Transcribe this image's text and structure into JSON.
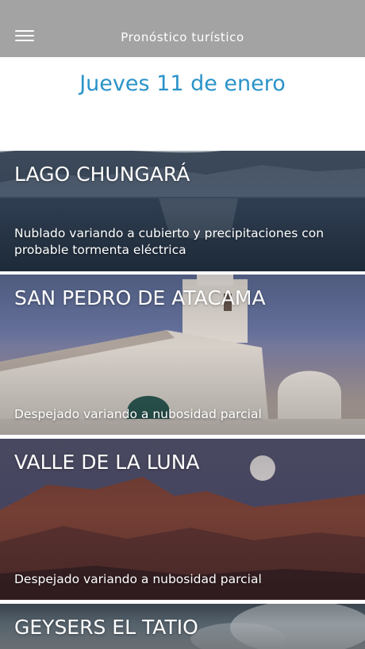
{
  "header": {
    "title": "Pronóstico turístico"
  },
  "date": "Jueves 11 de enero",
  "cards": [
    {
      "name": "LAGO CHUNGARÁ",
      "forecast": "Nublado variando a cubierto y precipitaciones con probable tormenta eléctrica"
    },
    {
      "name": "SAN PEDRO DE ATACAMA",
      "forecast": "Despejado variando a nubosidad parcial"
    },
    {
      "name": "VALLE DE LA LUNA",
      "forecast": "Despejado variando a nubosidad parcial"
    },
    {
      "name": "GEYSERS EL TATIO"
    }
  ],
  "colors": {
    "header_bg": "#a3a3a3",
    "date_text": "#2a93c9"
  },
  "icons": {
    "menu": "hamburger-menu-icon"
  }
}
